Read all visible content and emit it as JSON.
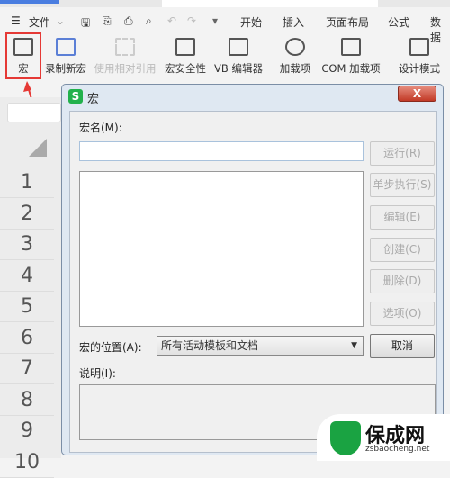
{
  "menu": {
    "file": "文件",
    "tabs": [
      "开始",
      "插入",
      "页面布局",
      "公式",
      "数据"
    ]
  },
  "ribbon": {
    "items": [
      {
        "label": "宏",
        "icon": "macro-icon",
        "enabled": true
      },
      {
        "label": "录制新宏",
        "icon": "record-macro-icon",
        "enabled": true
      },
      {
        "label": "使用相对引用",
        "icon": "relative-reference-icon",
        "enabled": false
      },
      {
        "label": "宏安全性",
        "icon": "macro-security-icon",
        "enabled": true
      },
      {
        "label": "VB 编辑器",
        "icon": "vb-editor-icon",
        "enabled": true
      },
      {
        "label": "加载项",
        "icon": "addins-icon",
        "enabled": true
      },
      {
        "label": "COM 加载项",
        "icon": "com-addins-icon",
        "enabled": true
      },
      {
        "label": "设计模式",
        "icon": "design-mode-icon",
        "enabled": true
      }
    ],
    "highlight_color": "#e53935"
  },
  "sheet": {
    "rows": [
      "1",
      "2",
      "3",
      "4",
      "5",
      "6",
      "7",
      "8",
      "9",
      "10"
    ]
  },
  "dialog": {
    "title": "宏",
    "close": "X",
    "name_label": "宏名(M):",
    "name_value": "",
    "buttons": {
      "run": "运行(R)",
      "step": "单步执行(S)",
      "edit": "编辑(E)",
      "create": "创建(C)",
      "delete": "删除(D)",
      "options": "选项(O)",
      "cancel": "取消"
    },
    "location_label": "宏的位置(A):",
    "location_value": "所有活动模板和文档",
    "desc_label": "说明(I):"
  },
  "watermark": {
    "text": "保成网",
    "url": "zsbaocheng.net"
  }
}
